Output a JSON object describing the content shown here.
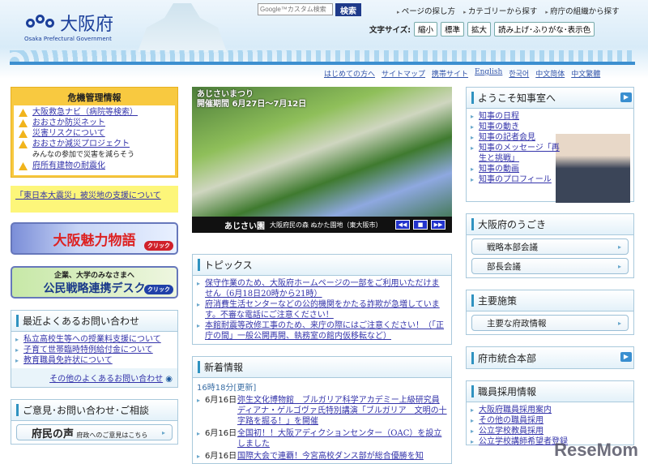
{
  "header": {
    "logo_title": "大阪府",
    "logo_sub": "Osaka Prefectural Government",
    "search_placeholder": "Google™カスタム検索",
    "search_button": "検索",
    "top_links": [
      "ページの探し方",
      "カテゴリーから探す",
      "府庁の組織から探す"
    ],
    "font_size_label": "文字サイズ:",
    "font_buttons": [
      "縮小",
      "標準",
      "拡大"
    ],
    "reader_button": "読み上げ･ふりがな･表示色",
    "nav": [
      "はじめての方へ",
      "サイトマップ",
      "携帯サイト",
      "English",
      "한국어",
      "中文简体",
      "中文繁體"
    ]
  },
  "crisis": {
    "title": "危機管理情報",
    "items": [
      "大阪救急ナビ（病院等検索）",
      "おおさか防災ネット",
      "災害リスクについて",
      "おおさか減災プロジェクト",
      "府所有建物の耐震化"
    ],
    "note": "みんなの参加で災害を減らそう"
  },
  "quake_link": "「東日本大震災」被災地の支援について",
  "banner1": {
    "text": "大阪魅力物語",
    "click": "クリック"
  },
  "banner2": {
    "top": "企業、大学のみなさまへ",
    "text": "公民戦略連携デスク",
    "click": "クリック"
  },
  "faq": {
    "title": "最近よくあるお問い合わせ",
    "items": [
      "私立高校生等への授業料支援について",
      "子育て世帯臨時特例給付金について",
      "教育職員免許状について"
    ],
    "more": "その他のよくあるお問い合わせ"
  },
  "contact": {
    "title": "ご意見･お問い合わせ･ご相談",
    "item": "府民の声",
    "item_sub": "府政へのご意見はこちら"
  },
  "slide": {
    "event": "あじさいまつり",
    "period": "開催期間 6月27日～7月12日",
    "place": "あじさい園",
    "location": "大阪府民の森 ぬかた園地（東大阪市）"
  },
  "topics": {
    "title": "トピックス",
    "items": [
      "保守作業のため、大阪府ホームページの一部をご利用いただけません（6月18日20時から21時）",
      "府消費生活センターなどの公的機関をかたる詐欺が急増しています。不審な電話にご注意ください！",
      "本館耐震等改修工事のため、来庁の際にはご注意ください！（「正庁の間」一般公開再開、執務室の館内仮移転など）"
    ]
  },
  "news": {
    "title": "新着情報",
    "updated": "16時18分[更新]",
    "items": [
      {
        "date": "6月16日",
        "text": "弥生文化博物館　ブルガリア科学アカデミー上級研究員ディアナ・ゲルゴヴァ氏特別講演「ブルガリア　文明の十字路を掘る！」を開催"
      },
      {
        "date": "6月16日",
        "text": "全国初！！大阪アディクションセンター（OAC）を設立しました"
      },
      {
        "date": "6月16日",
        "text": "国際大会で連覇！今宮高校ダンス部が総合優勝を知"
      }
    ]
  },
  "governor": {
    "title": "ようこそ知事室へ",
    "items": [
      "知事の日程",
      "知事の動き",
      "知事の記者会見",
      "知事のメッセージ「再生と挑戦」",
      "知事の動画",
      "知事のプロフィール"
    ]
  },
  "movement": {
    "title": "大阪府のうごき",
    "items": [
      "戦略本部会議",
      "部長会議"
    ]
  },
  "policy": {
    "title": "主要施策",
    "items": [
      "主要な府政情報"
    ]
  },
  "integration": {
    "title": "府市統合本部"
  },
  "recruit": {
    "title": "職員採用情報",
    "items": [
      "大阪府職員採用案内",
      "その他の職員採用",
      "公立学校教員採用",
      "公立学校講師希望者登録"
    ]
  },
  "watermark": "ReseMom"
}
